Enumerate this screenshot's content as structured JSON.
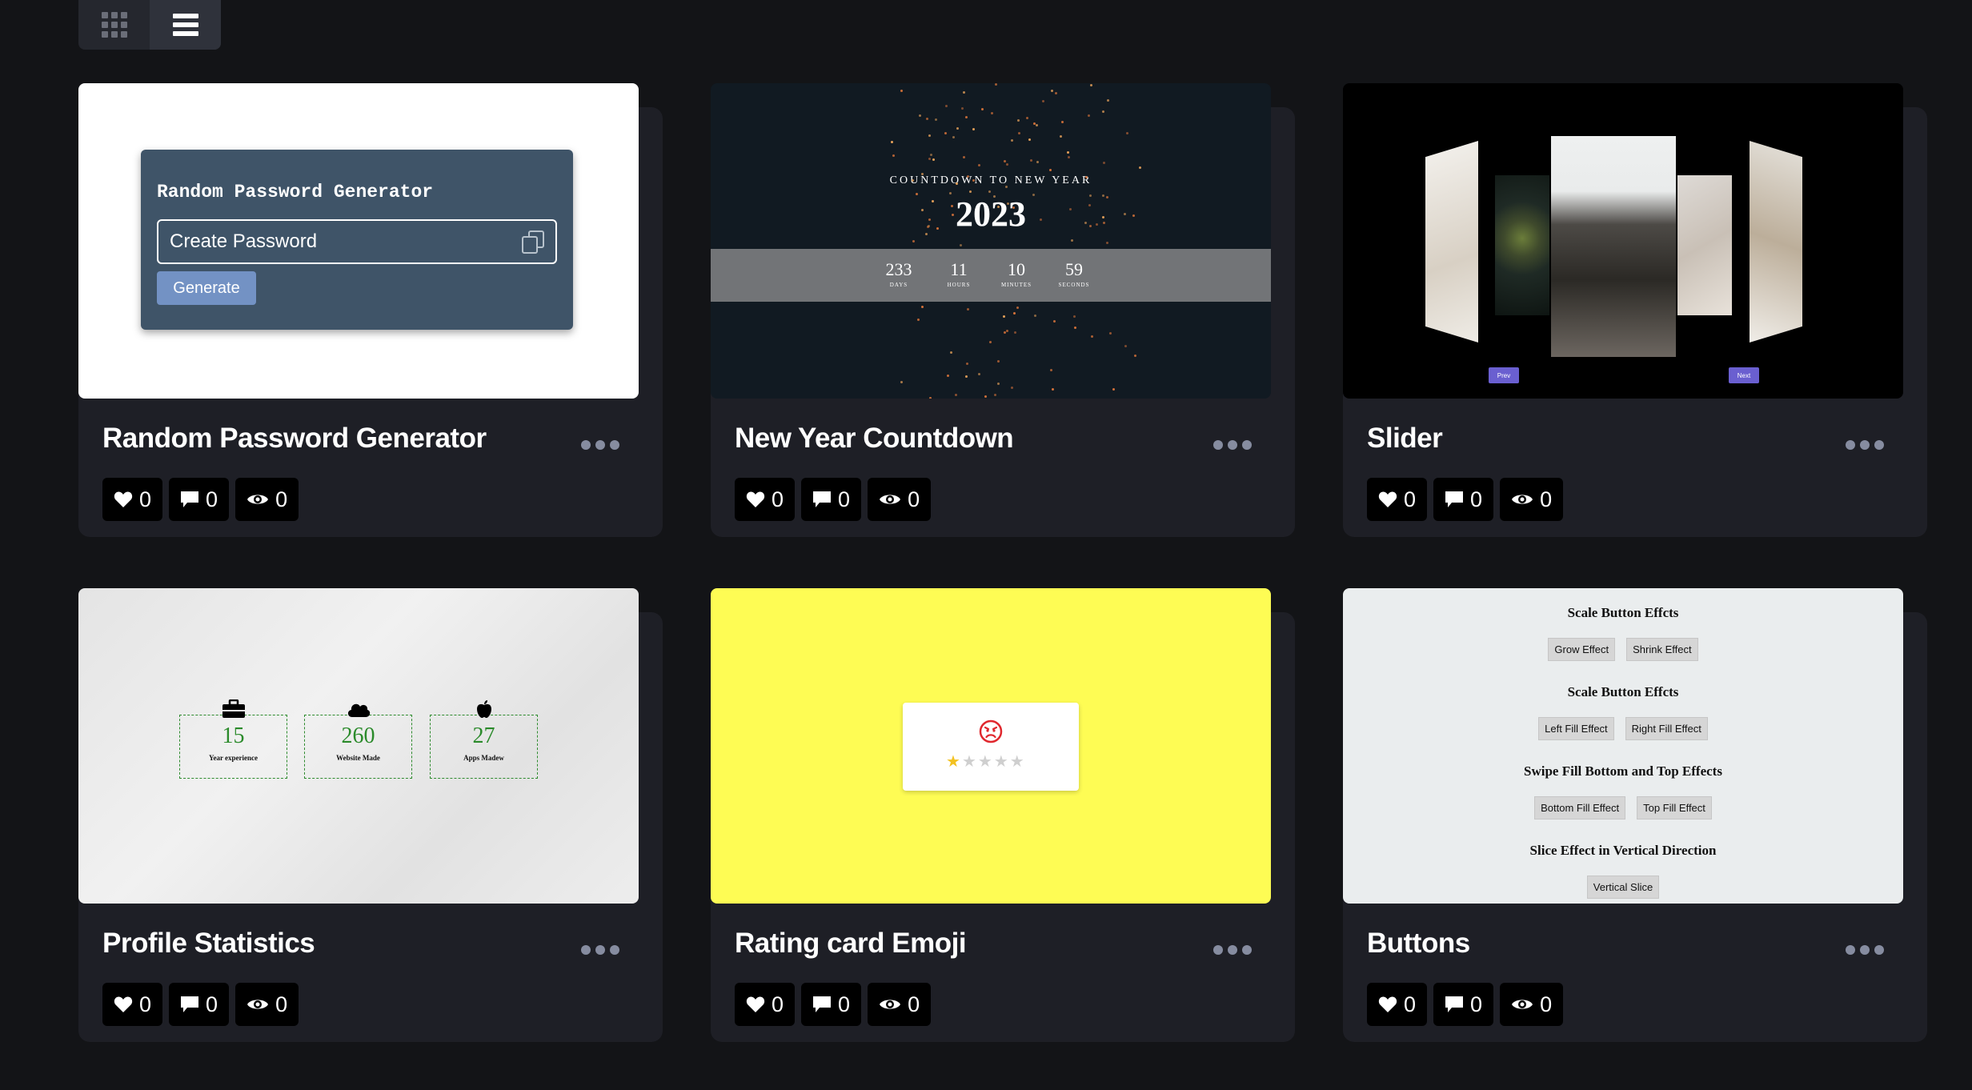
{
  "view_toggle": {
    "options": [
      "grid-view",
      "list-view"
    ],
    "active": "list-view"
  },
  "colors": {
    "page_bg": "#131417",
    "card_bg": "#1e1f26",
    "stat_bg": "#000000"
  },
  "cards": [
    {
      "title": "Random Password Generator",
      "stats": {
        "likes": "0",
        "comments": "0",
        "views": "0"
      },
      "preview": {
        "heading": "Random Password Generator",
        "input_placeholder": "Create Password",
        "button": "Generate"
      }
    },
    {
      "title": "New Year Countdown",
      "stats": {
        "likes": "0",
        "comments": "0",
        "views": "0"
      },
      "preview": {
        "subtitle": "COUNTDOWN TO NEW YEAR",
        "year": "2023",
        "units": [
          {
            "value": "233",
            "label": "DAYS"
          },
          {
            "value": "11",
            "label": "HOURS"
          },
          {
            "value": "10",
            "label": "MINUTES"
          },
          {
            "value": "59",
            "label": "SECONDS"
          }
        ]
      }
    },
    {
      "title": "Slider",
      "stats": {
        "likes": "0",
        "comments": "0",
        "views": "0"
      },
      "preview": {
        "prev": "Prev",
        "next": "Next"
      }
    },
    {
      "title": "Profile Statistics",
      "stats": {
        "likes": "0",
        "comments": "0",
        "views": "0"
      },
      "preview": {
        "items": [
          {
            "icon": "briefcase-icon",
            "value": "15",
            "label": "Year experience"
          },
          {
            "icon": "cloud-icon",
            "value": "260",
            "label": "Website Made"
          },
          {
            "icon": "apple-icon",
            "value": "27",
            "label": "Apps Madew"
          }
        ]
      }
    },
    {
      "title": "Rating card Emoji",
      "stats": {
        "likes": "0",
        "comments": "0",
        "views": "0"
      },
      "preview": {
        "emoji": "angry-face-icon",
        "rating": 1,
        "max_rating": 5
      }
    },
    {
      "title": "Buttons",
      "stats": {
        "likes": "0",
        "comments": "0",
        "views": "0"
      },
      "preview": {
        "sections": [
          {
            "heading": "Scale Button Effcts",
            "buttons": [
              "Grow Effect",
              "Shrink Effect"
            ]
          },
          {
            "heading": "Scale Button Effcts",
            "buttons": [
              "Left Fill Effect",
              "Right Fill Effect"
            ]
          },
          {
            "heading": "Swipe Fill Bottom and Top Effects",
            "buttons": [
              "Bottom Fill Effect",
              "Top Fill Effect"
            ]
          },
          {
            "heading": "Slice Effect in Vertical Direction",
            "buttons": [
              "Vertical Slice"
            ]
          }
        ]
      }
    }
  ]
}
